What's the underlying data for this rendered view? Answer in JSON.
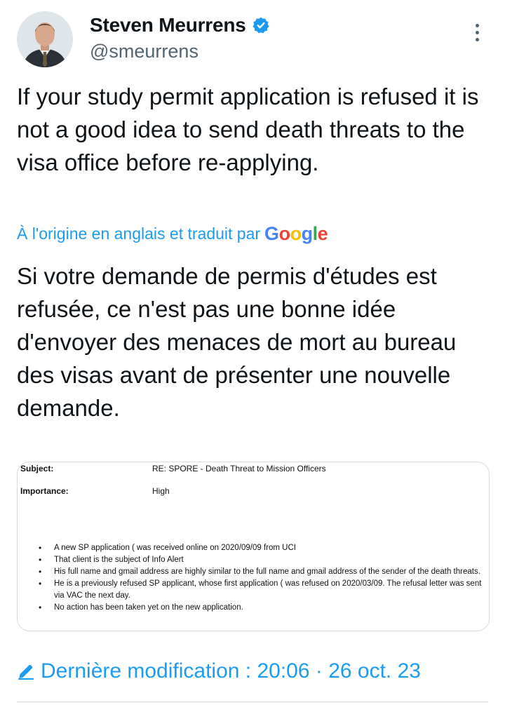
{
  "author": {
    "display_name": "Steven Meurrens",
    "handle": "@smeurrens"
  },
  "tweet": {
    "text": "If your study permit application is refused it is not a good idea to send death threats to the visa office before re-applying."
  },
  "translation": {
    "label": "À l'origine en anglais et traduit par",
    "provider": "Google",
    "text": "Si votre demande de permis d'études est refusée, ce n'est pas une bonne idée d'envoyer des menaces de mort au bureau des visas avant de présenter une nouvelle demande."
  },
  "email": {
    "subject_label": "Subject:",
    "subject_value": "RE: SPORE - Death Threat to Mission Officers",
    "importance_label": "Importance:",
    "importance_value": "High",
    "bullets": [
      "A new SP application (                         was received online on 2020/09/09 from UCI",
      "That client is the subject of Info Alert",
      "His full name and gmail address are highly similar to the full name and gmail address of the sender of the death threats.",
      "He is a previously refused SP applicant, whose first application (                              was refused on 2020/03/09.  The refusal letter was sent via VAC the next day.",
      "No action has been taken yet on the new application."
    ]
  },
  "footer": {
    "edit_text": "Dernière modification : 20:06 · 26 oct. 23"
  },
  "colors": {
    "link": "#1d9bf0",
    "secondary_text": "#536471",
    "verified": "#1d9bf0"
  },
  "icons": [
    "avatar",
    "verified-badge-icon",
    "more-icon",
    "pencil-icon"
  ]
}
